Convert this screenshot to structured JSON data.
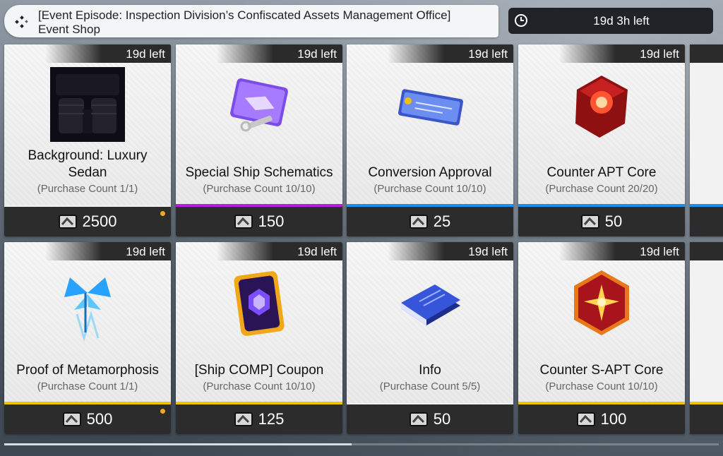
{
  "header": {
    "title_line1": "[Event Episode: Inspection Division’s Confiscated Assets Management Office]",
    "title_line2": "Event Shop",
    "timer": "19d 3h left"
  },
  "currency_icon": "ticket-currency-icon",
  "colors": {
    "purple": "#b51ee0",
    "blue": "#1e8fe8",
    "yellow": "#f2c200",
    "dot": "#f4a81d"
  },
  "items": [
    {
      "badge": "19d left",
      "name": "Background: Luxury Sedan",
      "count": "(Purchase Count 1/1)",
      "price": "2500",
      "accent": "none",
      "icon": "car-interior-icon"
    },
    {
      "badge": "19d left",
      "name": "Special Ship Schematics",
      "count": "(Purchase Count 10/10)",
      "price": "150",
      "accent": "purple",
      "icon": "ship-schematics-icon"
    },
    {
      "badge": "19d left",
      "name": "Conversion Approval",
      "count": "(Purchase Count 10/10)",
      "price": "25",
      "accent": "blue",
      "icon": "approval-ticket-icon"
    },
    {
      "badge": "19d left",
      "name": "Counter APT Core",
      "count": "(Purchase Count 20/20)",
      "price": "50",
      "accent": "blue",
      "icon": "apt-core-icon"
    },
    {
      "badge": "19d left",
      "name": "Proof of Metamorphosis",
      "count": "(Purchase Count 1/1)",
      "price": "500",
      "accent": "yellow",
      "icon": "butterfly-crystal-icon"
    },
    {
      "badge": "19d left",
      "name": "[Ship COMP] Coupon",
      "count": "(Purchase Count 10/10)",
      "price": "125",
      "accent": "yellow",
      "icon": "comp-coupon-icon"
    },
    {
      "badge": "19d left",
      "name": "Info",
      "count": "(Purchase Count 5/5)",
      "price": "50",
      "accent": "none",
      "icon": "info-book-icon"
    },
    {
      "badge": "19d left",
      "name": "Counter S-APT Core",
      "count": "(Purchase Count 10/10)",
      "price": "100",
      "accent": "yellow",
      "icon": "s-apt-core-icon"
    }
  ]
}
